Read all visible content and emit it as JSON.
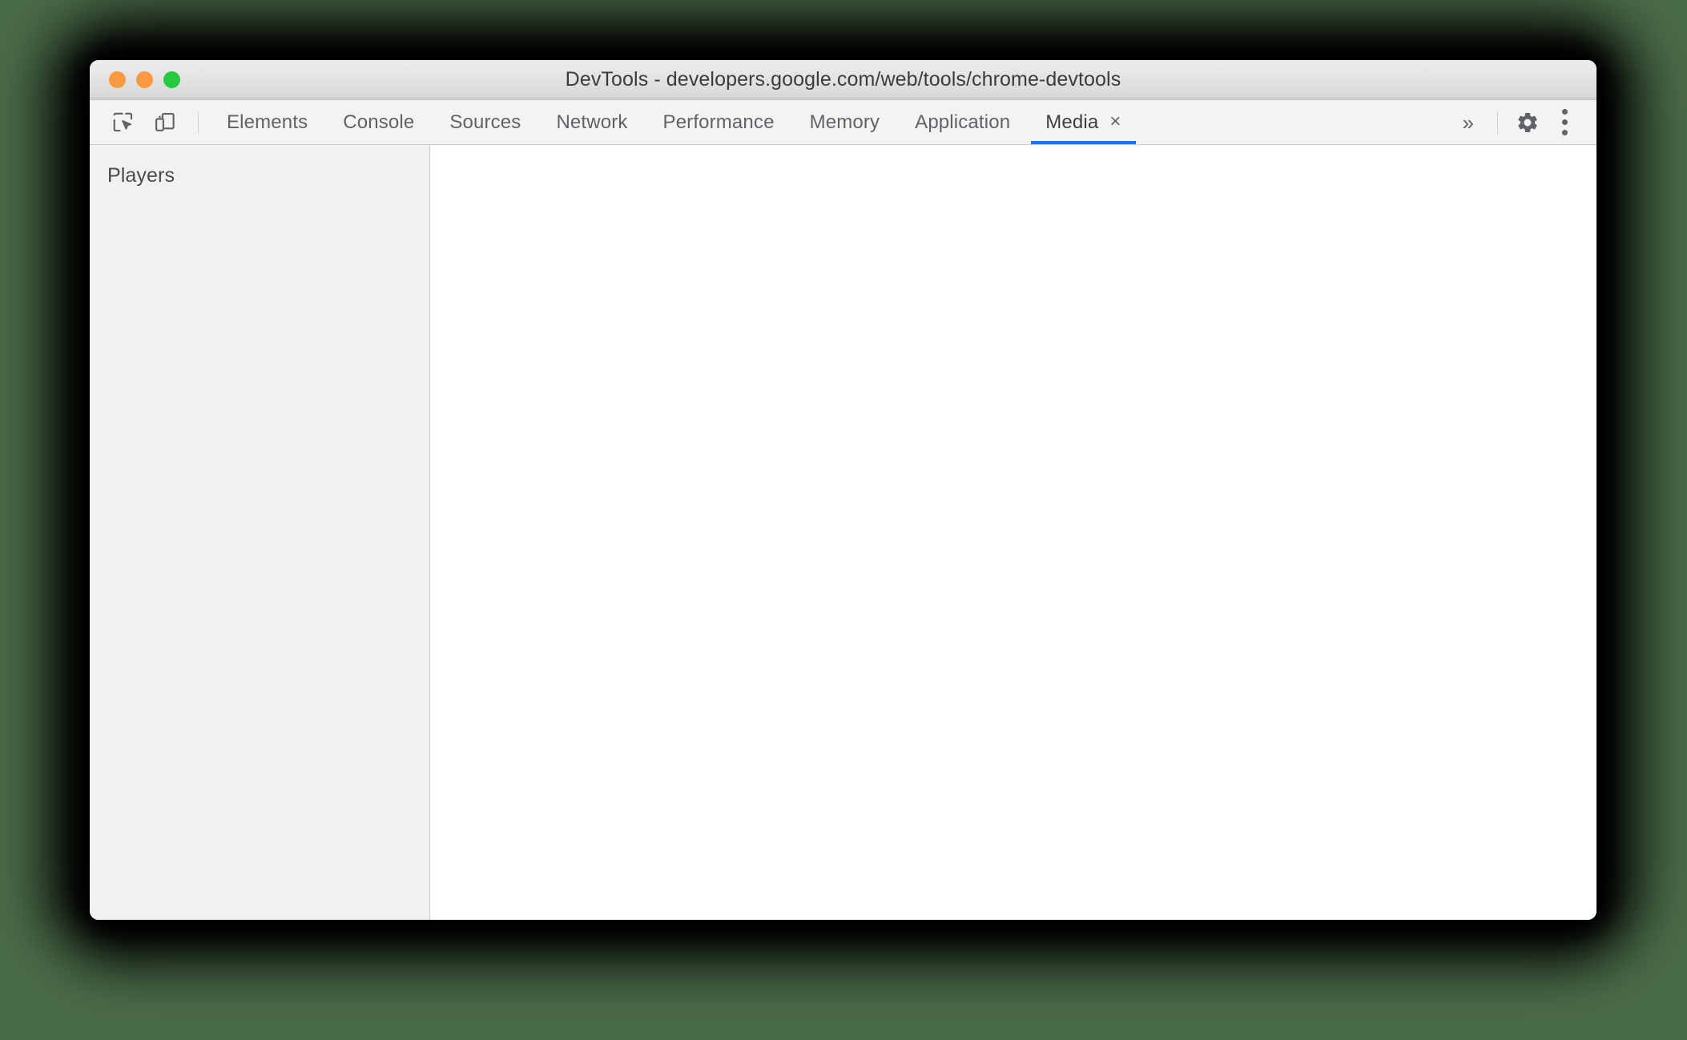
{
  "window": {
    "title": "DevTools - developers.google.com/web/tools/chrome-devtools",
    "traffic_lights": [
      {
        "name": "close",
        "color": "#f79a40"
      },
      {
        "name": "minimize",
        "color": "#f79a40"
      },
      {
        "name": "zoom",
        "color": "#27c93f"
      }
    ]
  },
  "toolbar": {
    "inspect_icon": "inspect-element-icon",
    "device_icon": "device-toolbar-icon",
    "more_tabs_label": "»",
    "settings_icon": "gear-icon",
    "more_options_icon": "kebab-menu-icon",
    "tabs": [
      {
        "label": "Elements",
        "active": false,
        "closable": false
      },
      {
        "label": "Console",
        "active": false,
        "closable": false
      },
      {
        "label": "Sources",
        "active": false,
        "closable": false
      },
      {
        "label": "Network",
        "active": false,
        "closable": false
      },
      {
        "label": "Performance",
        "active": false,
        "closable": false
      },
      {
        "label": "Memory",
        "active": false,
        "closable": false
      },
      {
        "label": "Application",
        "active": false,
        "closable": false
      },
      {
        "label": "Media",
        "active": true,
        "closable": true,
        "close_label": "×"
      }
    ],
    "active_tab_accent": "#1a73e8"
  },
  "sidebar": {
    "title": "Players",
    "items": []
  },
  "main": {
    "content": ""
  },
  "colors": {
    "desktop_background": "#4a6b48",
    "titlebar_top": "#ececec",
    "titlebar_bottom": "#c9c9c9",
    "toolbar_background": "#f3f3f3",
    "sidebar_background": "#f1f1f1",
    "main_background": "#ffffff",
    "text_primary": "#3c4043",
    "text_secondary": "#5f6368"
  }
}
